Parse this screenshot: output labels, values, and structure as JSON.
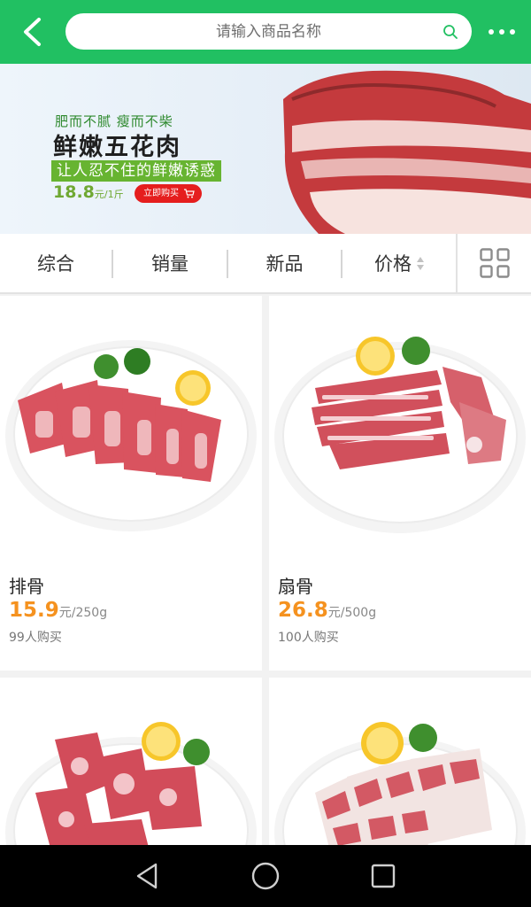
{
  "search": {
    "placeholder": "请输入商品名称"
  },
  "banner": {
    "slogan": "肥而不腻  瘦而不柴",
    "title": "鲜嫩五花肉",
    "tagline": "让人忍不住的鲜嫩诱惑",
    "price": "18.8",
    "price_unit": "元/1斤",
    "buy_label": "立即购买"
  },
  "sort": {
    "tabs": [
      "综合",
      "销量",
      "新品",
      "价格"
    ]
  },
  "products": [
    {
      "name": "排骨",
      "price": "15.9",
      "unit": "元/250g",
      "sales": "99人购买"
    },
    {
      "name": "扇骨",
      "price": "26.8",
      "unit": "元/500g",
      "sales": "100人购买"
    },
    {
      "name": "",
      "price": "",
      "unit": "",
      "sales": ""
    },
    {
      "name": "",
      "price": "",
      "unit": "",
      "sales": ""
    }
  ],
  "colors": {
    "brand": "#21c062",
    "price": "#f5921f",
    "buy": "#e51e1e"
  },
  "icons": [
    "back-icon",
    "search-icon",
    "more-icon",
    "cart-icon",
    "sort-arrows-icon",
    "grid-view-icon",
    "nav-back-icon",
    "nav-home-icon",
    "nav-recents-icon"
  ]
}
